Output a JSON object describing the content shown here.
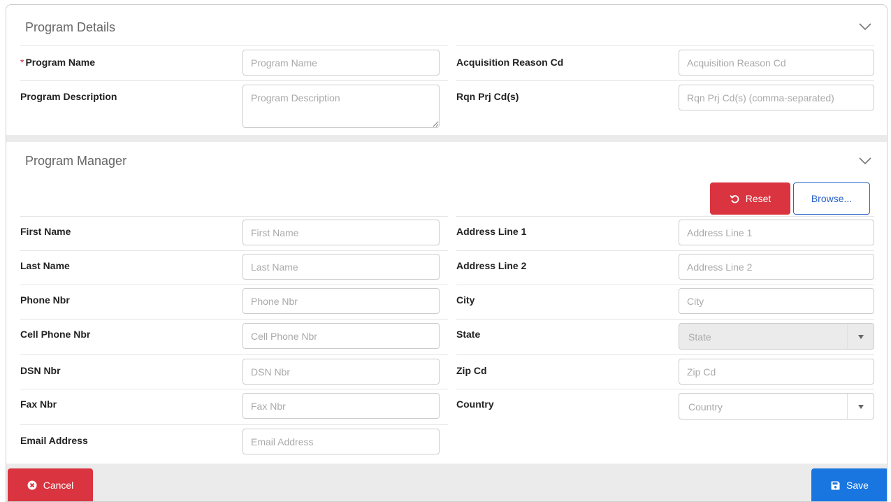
{
  "program_details": {
    "title": "Program Details",
    "fields": {
      "program_name": {
        "label": "Program Name",
        "required_mark": "*",
        "placeholder": "Program Name"
      },
      "program_description": {
        "label": "Program Description",
        "placeholder": "Program Description"
      },
      "acquisition_reason_cd": {
        "label": "Acquisition Reason Cd",
        "placeholder": "Acquisition Reason Cd"
      },
      "rqn_prj_cds": {
        "label": "Rqn Prj Cd(s)",
        "placeholder": "Rqn Prj Cd(s) (comma-separated)"
      }
    }
  },
  "program_manager": {
    "title": "Program Manager",
    "reset_label": "Reset",
    "browse_label": "Browse...",
    "fields": {
      "first_name": {
        "label": "First Name",
        "placeholder": "First Name"
      },
      "last_name": {
        "label": "Last Name",
        "placeholder": "Last Name"
      },
      "phone_nbr": {
        "label": "Phone Nbr",
        "placeholder": "Phone Nbr"
      },
      "cell_phone_nbr": {
        "label": "Cell Phone Nbr",
        "placeholder": "Cell Phone Nbr"
      },
      "dsn_nbr": {
        "label": "DSN Nbr",
        "placeholder": "DSN Nbr"
      },
      "fax_nbr": {
        "label": "Fax Nbr",
        "placeholder": "Fax Nbr"
      },
      "email_address": {
        "label": "Email Address",
        "placeholder": "Email Address"
      },
      "address_line_1": {
        "label": "Address Line 1",
        "placeholder": "Address Line 1"
      },
      "address_line_2": {
        "label": "Address Line 2",
        "placeholder": "Address Line 2"
      },
      "city": {
        "label": "City",
        "placeholder": "City"
      },
      "state": {
        "label": "State",
        "placeholder": "State"
      },
      "zip_cd": {
        "label": "Zip Cd",
        "placeholder": "Zip Cd"
      },
      "country": {
        "label": "Country",
        "placeholder": "Country"
      }
    }
  },
  "footer": {
    "cancel_label": "Cancel",
    "save_label": "Save"
  },
  "colors": {
    "danger": "#d9343f",
    "primary": "#1976e0",
    "link": "#2a62c9",
    "panel_separator": "#ebebeb"
  },
  "icons": {
    "collapse": "chevron-down-icon",
    "reset": "undo-icon",
    "cancel": "times-circle-icon",
    "save": "floppy-disk-icon",
    "dropdown": "caret-down-icon"
  }
}
